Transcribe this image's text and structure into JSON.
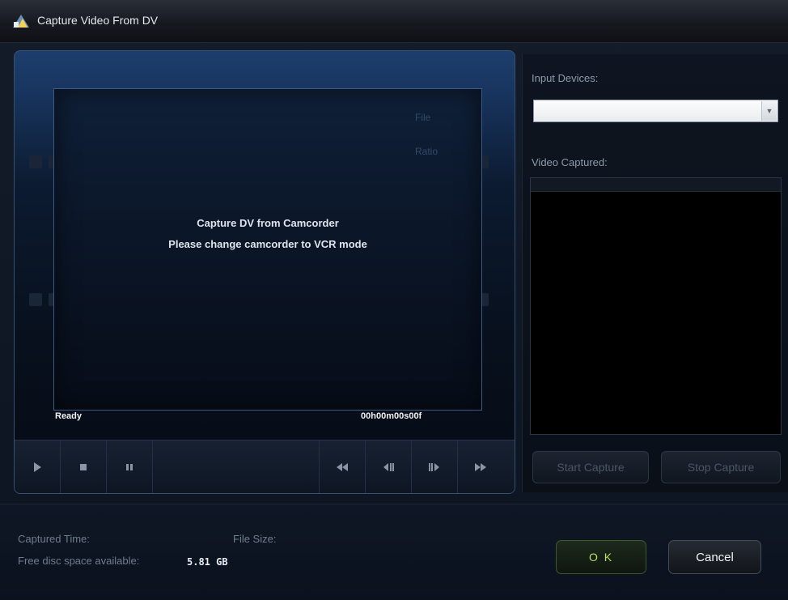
{
  "window": {
    "title": "Capture Video From DV"
  },
  "preview": {
    "ghost_line_1": "File",
    "ghost_line_2": "Ratio",
    "message_line_1": "Capture DV from Camcorder",
    "message_line_2": "Please change camcorder to VCR mode",
    "status": "Ready",
    "timecode": "00h00m00s00f"
  },
  "controls": {
    "icons": [
      "play-icon",
      "stop-icon",
      "pause-icon",
      "rewind-icon",
      "step-back-icon",
      "step-forward-icon",
      "fast-forward-icon"
    ]
  },
  "right_panel": {
    "input_devices_label": "Input Devices:",
    "input_devices_value": "",
    "video_captured_label": "Video Captured:",
    "start_capture_label": "Start Capture",
    "stop_capture_label": "Stop Capture"
  },
  "bottom": {
    "captured_time_label": "Captured Time:",
    "file_size_label": "File Size:",
    "free_space_label": "Free disc space available:",
    "free_space_value": "5.81 GB",
    "ok_label": "O K",
    "cancel_label": "Cancel"
  },
  "colors": {
    "accent_ok": "#b5e05b",
    "panel_blue": "#1d3e6d",
    "background": "#0b1220"
  }
}
